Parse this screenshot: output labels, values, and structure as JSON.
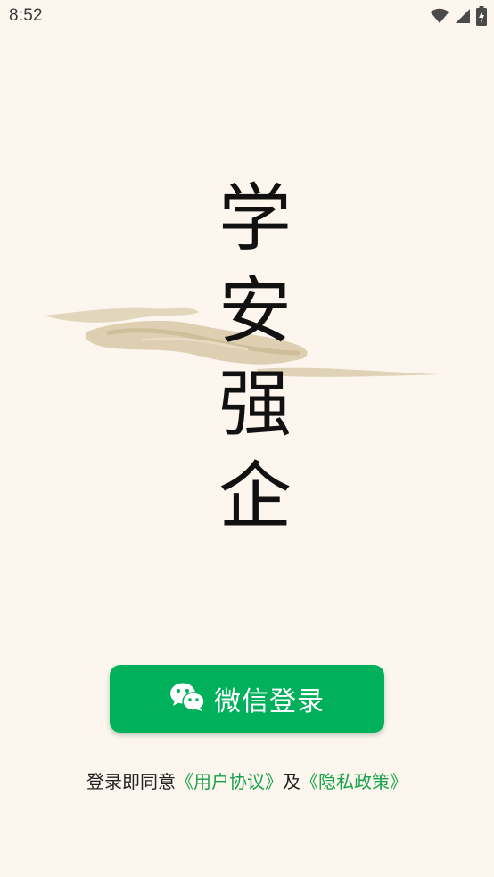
{
  "status_bar": {
    "time": "8:52",
    "icons": [
      "wifi-icon",
      "cell-signal-icon",
      "battery-charging-icon"
    ]
  },
  "app": {
    "title_chars": [
      "学",
      "安",
      "强",
      "企"
    ]
  },
  "login": {
    "button_label": "微信登录",
    "icon": "wechat-icon"
  },
  "agreement": {
    "prefix": "登录即同意",
    "user_agreement_link": "《用户协议》",
    "conjunction": "及",
    "privacy_policy_link": "《隐私政策》"
  },
  "colors": {
    "background": "#fdf6ef",
    "accent_green": "#00b05a",
    "link_green": "#16a34a",
    "brush_tan": "#d8c9a9"
  }
}
